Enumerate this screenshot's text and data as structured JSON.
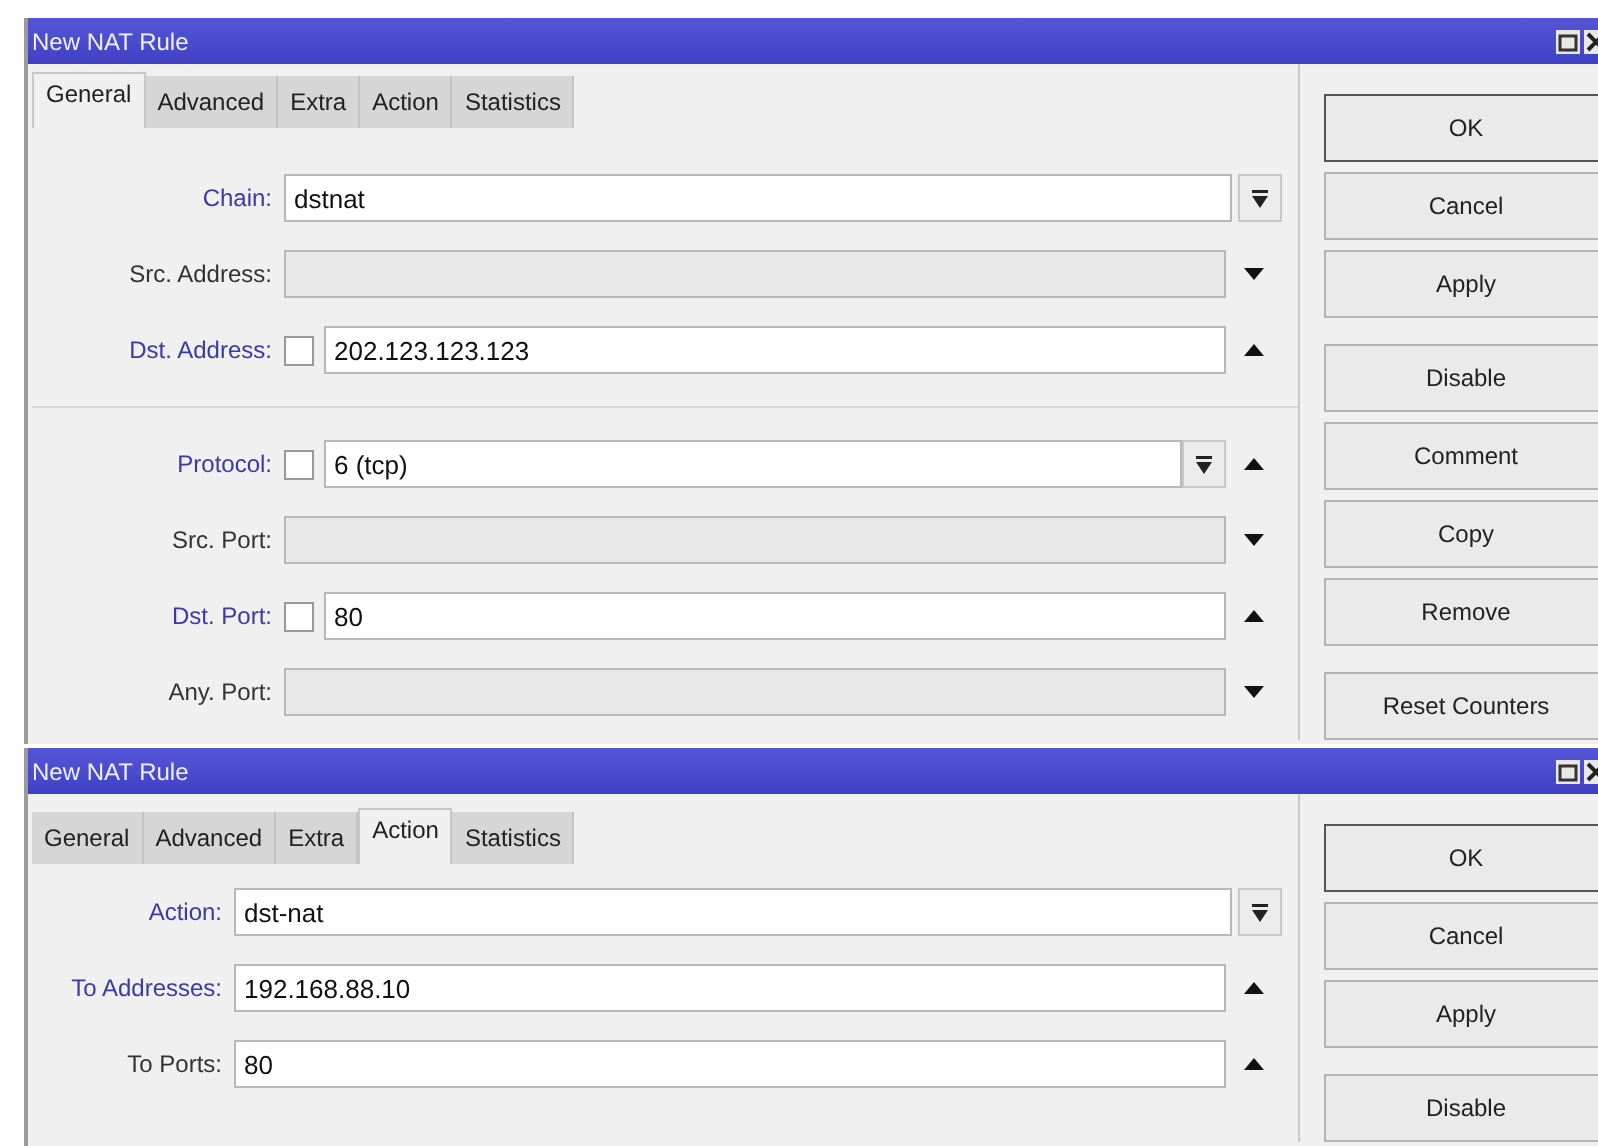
{
  "windows": [
    {
      "title": "New NAT Rule",
      "tabs": [
        {
          "label": "General",
          "selected": true
        },
        {
          "label": "Advanced",
          "selected": false
        },
        {
          "label": "Extra",
          "selected": false
        },
        {
          "label": "Action",
          "selected": false
        },
        {
          "label": "Statistics",
          "selected": false
        }
      ],
      "rows": [
        {
          "kind": "field",
          "label": "Chain:",
          "highlighted": true,
          "value": "dstnat",
          "dropdown": true
        },
        {
          "kind": "field",
          "label": "Src. Address:",
          "highlighted": false,
          "dropdown": false,
          "expanded": false
        },
        {
          "kind": "field",
          "label": "Dst. Address:",
          "highlighted": true,
          "checked": false,
          "value": "202.123.123.123",
          "dropdown": false,
          "expanded": true
        },
        {
          "kind": "separator"
        },
        {
          "kind": "field",
          "label": "Protocol:",
          "highlighted": true,
          "checked": false,
          "value": "6 (tcp)",
          "dropdown": true,
          "expanded": true
        },
        {
          "kind": "field",
          "label": "Src. Port:",
          "highlighted": false,
          "dropdown": false,
          "expanded": false
        },
        {
          "kind": "field",
          "label": "Dst. Port:",
          "highlighted": true,
          "checked": false,
          "value": "80",
          "dropdown": false,
          "expanded": true
        },
        {
          "kind": "field",
          "label": "Any. Port:",
          "highlighted": false,
          "dropdown": false,
          "expanded": false
        }
      ],
      "button_groups": [
        [
          {
            "label": "OK",
            "default": true
          },
          {
            "label": "Cancel",
            "default": false
          },
          {
            "label": "Apply",
            "default": false
          }
        ],
        [
          {
            "label": "Disable",
            "default": false
          },
          {
            "label": "Comment",
            "default": false
          },
          {
            "label": "Copy",
            "default": false
          },
          {
            "label": "Remove",
            "default": false
          }
        ],
        [
          {
            "label": "Reset Counters",
            "default": false
          }
        ]
      ]
    },
    {
      "title": "New NAT Rule",
      "tabs": [
        {
          "label": "General",
          "selected": false
        },
        {
          "label": "Advanced",
          "selected": false
        },
        {
          "label": "Extra",
          "selected": false
        },
        {
          "label": "Action",
          "selected": true
        },
        {
          "label": "Statistics",
          "selected": false
        }
      ],
      "rows": [
        {
          "kind": "field",
          "label": "Action:",
          "highlighted": true,
          "value": "dst-nat",
          "dropdown": true
        },
        {
          "kind": "field",
          "label": "To Addresses:",
          "highlighted": true,
          "value": "192.168.88.10",
          "dropdown": false,
          "expanded": true
        },
        {
          "kind": "field",
          "label": "To Ports:",
          "highlighted": false,
          "value": "80",
          "dropdown": false,
          "expanded": true
        }
      ],
      "button_groups": [
        [
          {
            "label": "OK",
            "default": true
          },
          {
            "label": "Cancel",
            "default": false
          },
          {
            "label": "Apply",
            "default": false
          }
        ],
        [
          {
            "label": "Disable",
            "default": false
          }
        ]
      ]
    }
  ]
}
